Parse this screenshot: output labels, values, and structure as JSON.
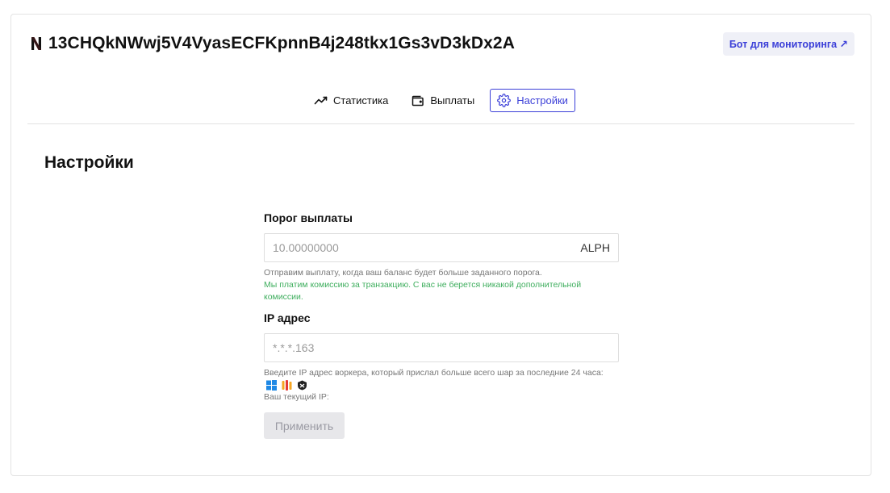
{
  "header": {
    "wallet_address": "13CHQkNWwj5V4VyasECFKpnnB4j248tkx1Gs3vD3kDx2A",
    "monitor_bot_label": "Бот для мониторинга ↗"
  },
  "tabs": [
    {
      "label": "Статистика",
      "icon": "chart-line-icon"
    },
    {
      "label": "Выплаты",
      "icon": "wallet-icon"
    },
    {
      "label": "Настройки",
      "icon": "gear-icon",
      "active": true
    }
  ],
  "settings": {
    "title": "Настройки",
    "threshold": {
      "label": "Порог выплаты",
      "placeholder": "10.00000000",
      "unit": "ALPH",
      "hint": "Отправим выплату, когда ваш баланс будет больше заданного порога.",
      "fee_note": "Мы платим комиссию за транзакцию. С вас не берется никакой дополнительной комиссии."
    },
    "ip": {
      "label": "IP адрес",
      "placeholder": "*.*.*.163",
      "hint": "Введите IP адрес воркера, который прислал больше всего шар за последние 24 часа:",
      "os_icons": [
        "windows-icon",
        "hiveos-icon",
        "rave-os-icon"
      ],
      "current_ip_label": "Ваш текущий IP:"
    },
    "apply_label": "Применить"
  },
  "colors": {
    "accent": "#3b3fd8",
    "fee_note": "#3fae5e",
    "apply_disabled_bg": "#e7e7ea"
  }
}
